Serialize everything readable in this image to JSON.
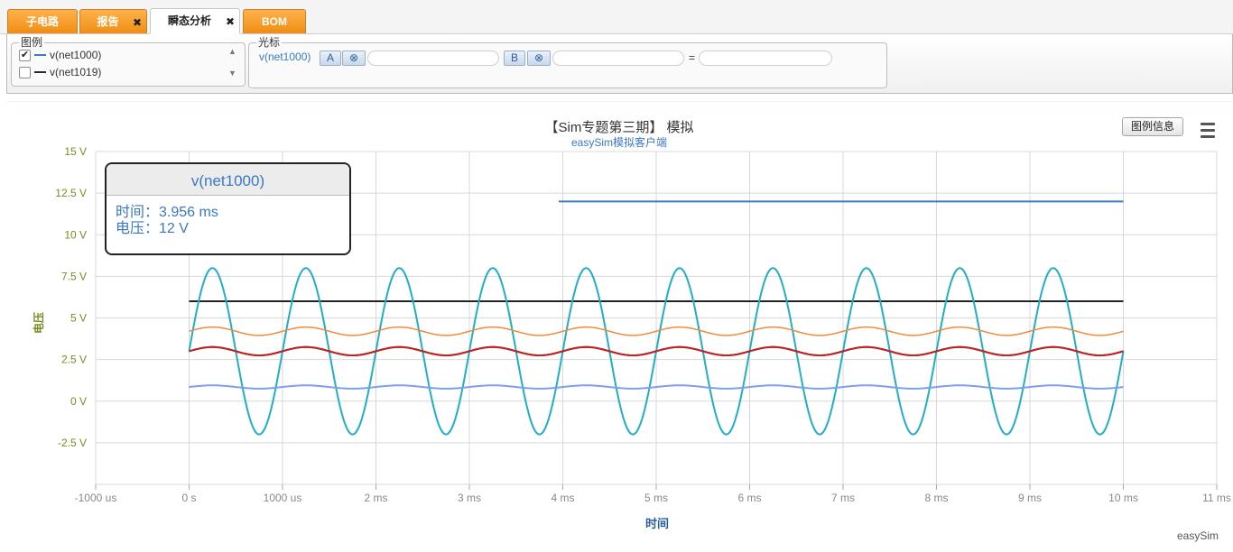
{
  "tabs": [
    {
      "label": "子电路",
      "closable": false,
      "active": false
    },
    {
      "label": "报告",
      "closable": true,
      "active": false
    },
    {
      "label": "瞬态分析",
      "closable": true,
      "active": true
    },
    {
      "label": "BOM",
      "closable": false,
      "active": false
    }
  ],
  "legend_panel": {
    "title": "图例",
    "items": [
      {
        "label": "v(net1000)",
        "checked": true,
        "color": "#3a7ac6"
      },
      {
        "label": "v(net1019)",
        "checked": false,
        "color": "#1f2b3b"
      }
    ]
  },
  "cursor_panel": {
    "title": "光标",
    "signal": "v(net1000)",
    "btn_a": "A",
    "btn_b": "B",
    "clear_icon": "⊗",
    "input_a": "",
    "input_b": "",
    "equals": "=",
    "result": ""
  },
  "chart": {
    "legend_info_button": "图例信息",
    "credit": "easySim",
    "tooltip": {
      "series": "v(net1000)",
      "time_line": "时间：3.956 ms",
      "voltage_line": "电压：12 V"
    }
  },
  "chart_data": {
    "type": "line",
    "title": "【Sim专题第三期】 模拟",
    "subtitle": "easySim模拟客户端",
    "xlabel": "时间",
    "ylabel": "电压",
    "x_unit": "ms",
    "xlim": [
      -1,
      11
    ],
    "ylim": [
      -5,
      15
    ],
    "x_ticks": [
      {
        "v": -1,
        "label": "-1000 us"
      },
      {
        "v": 0,
        "label": "0 s"
      },
      {
        "v": 1,
        "label": "1000 us"
      },
      {
        "v": 2,
        "label": "2 ms"
      },
      {
        "v": 3,
        "label": "3 ms"
      },
      {
        "v": 4,
        "label": "4 ms"
      },
      {
        "v": 5,
        "label": "5 ms"
      },
      {
        "v": 6,
        "label": "6 ms"
      },
      {
        "v": 7,
        "label": "7 ms"
      },
      {
        "v": 8,
        "label": "8 ms"
      },
      {
        "v": 9,
        "label": "9 ms"
      },
      {
        "v": 10,
        "label": "10 ms"
      },
      {
        "v": 11,
        "label": "11 ms"
      }
    ],
    "y_ticks": [
      {
        "v": -2.5,
        "label": "-2.5 V"
      },
      {
        "v": 0,
        "label": "0 V"
      },
      {
        "v": 2.5,
        "label": "2.5 V"
      },
      {
        "v": 5,
        "label": "5 V"
      },
      {
        "v": 7.5,
        "label": "7.5 V"
      },
      {
        "v": 10,
        "label": "10 V"
      },
      {
        "v": 12.5,
        "label": "12.5 V"
      },
      {
        "v": 15,
        "label": "15 V"
      }
    ],
    "grid": true,
    "series": [
      {
        "color": "#3a7ac6",
        "width": 2,
        "kind": "constant",
        "x_start": 3.956,
        "x_end": 10,
        "value": 12
      },
      {
        "color": "#222222",
        "width": 2,
        "kind": "constant",
        "x_start": 0,
        "x_end": 10,
        "value": 6
      },
      {
        "color": "#21aec8",
        "width": 2,
        "kind": "sine",
        "x_start": 0,
        "x_end": 10,
        "offset": 3,
        "amplitude": 5,
        "freq_khz": 1,
        "phase_deg": 0
      },
      {
        "color": "#f08a3c",
        "width": 1.5,
        "kind": "sine",
        "x_start": 0,
        "x_end": 10,
        "offset": 4.2,
        "amplitude": 0.25,
        "freq_khz": 1,
        "phase_deg": 0
      },
      {
        "color": "#222222",
        "width": 2,
        "kind": "sine",
        "x_start": 0,
        "x_end": 10,
        "offset": 3.0,
        "amplitude": 0.25,
        "freq_khz": 1,
        "phase_deg": 0
      },
      {
        "color": "#c3241e",
        "width": 2,
        "kind": "sine",
        "x_start": 0,
        "x_end": 10,
        "offset": 3.0,
        "amplitude": 0.25,
        "freq_khz": 1,
        "phase_deg": 0
      },
      {
        "color": "#7da0e8",
        "width": 2,
        "kind": "sine",
        "x_start": 0,
        "x_end": 10,
        "offset": 0.85,
        "amplitude": 0.1,
        "freq_khz": 1,
        "phase_deg": 0
      }
    ]
  }
}
